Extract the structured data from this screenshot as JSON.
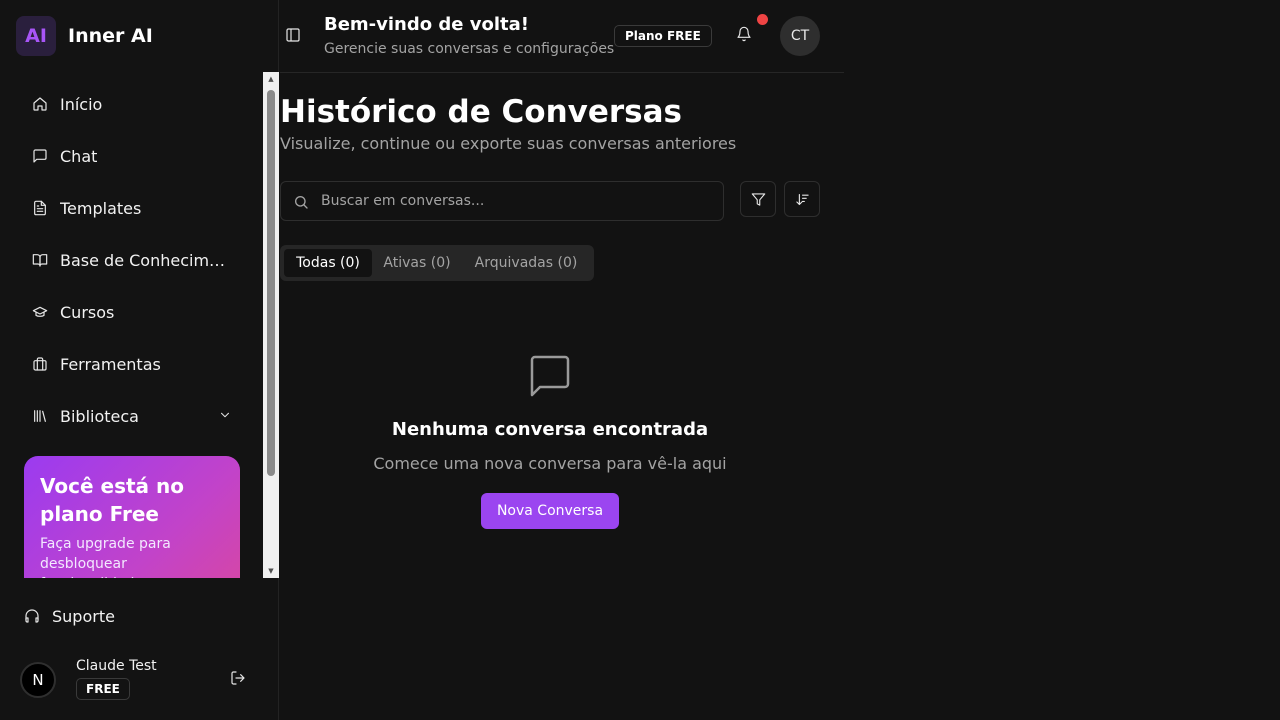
{
  "app": {
    "logo_badge": "AI",
    "name": "Inner AI"
  },
  "sidebar": {
    "items": [
      {
        "label": "Início",
        "icon": "home-icon"
      },
      {
        "label": "Chat",
        "icon": "message-square-icon"
      },
      {
        "label": "Templates",
        "icon": "file-text-icon"
      },
      {
        "label": "Base de Conhecimento",
        "icon": "book-open-icon"
      },
      {
        "label": "Cursos",
        "icon": "graduation-cap-icon"
      },
      {
        "label": "Ferramentas",
        "icon": "briefcase-icon"
      },
      {
        "label": "Biblioteca",
        "icon": "library-icon",
        "expandable": true
      }
    ],
    "upgrade": {
      "title": "Você está no plano Free",
      "subtitle": "Faça upgrade para desbloquear funcionalidades"
    },
    "support_label": "Suporte",
    "user": {
      "avatar_initial": "N",
      "name": "Claude Test",
      "plan": "FREE"
    }
  },
  "header": {
    "welcome": "Bem-vindo de volta!",
    "subtitle": "Gerencie suas conversas e configurações",
    "plan_badge": "Plano FREE",
    "avatar_initials": "CT"
  },
  "main": {
    "title": "Histórico de Conversas",
    "subtitle": "Visualize, continue ou exporte suas conversas anteriores",
    "search_placeholder": "Buscar em conversas...",
    "tabs": [
      {
        "label": "Todas (0)",
        "active": true
      },
      {
        "label": "Ativas (0)",
        "active": false
      },
      {
        "label": "Arquivadas (0)",
        "active": false
      }
    ],
    "empty": {
      "title": "Nenhuma conversa encontrada",
      "subtitle": "Comece uma nova conversa para vê-la aqui",
      "button_label": "Nova Conversa"
    }
  },
  "colors": {
    "accent": "#9b45f0",
    "background": "#121212",
    "notification": "#ef4444"
  }
}
